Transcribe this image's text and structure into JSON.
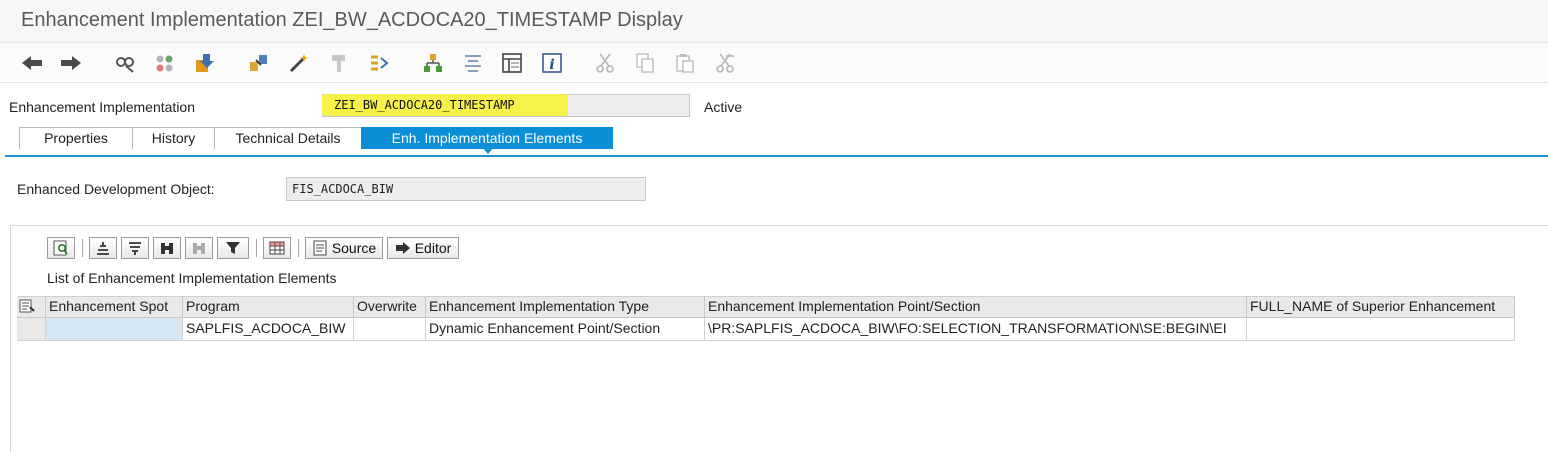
{
  "window": {
    "title": "Enhancement Implementation ZEI_BW_ACDOCA20_TIMESTAMP Display"
  },
  "toolbar": {
    "buttons": [
      {
        "icon": "back-arrow-icon"
      },
      {
        "icon": "forward-arrow-icon"
      },
      {
        "icon": "display-change-icon"
      },
      {
        "icon": "other-object-icon"
      },
      {
        "icon": "activate-icon"
      },
      {
        "icon": "where-used-icon"
      },
      {
        "icon": "magic-wand-icon"
      },
      {
        "icon": "hammer-icon"
      },
      {
        "icon": "enhance-icon"
      },
      {
        "icon": "hierarchy-icon"
      },
      {
        "icon": "align-icon"
      },
      {
        "icon": "layout-icon"
      },
      {
        "icon": "info-icon"
      },
      {
        "icon": "cut-icon"
      },
      {
        "icon": "copy-icon"
      },
      {
        "icon": "paste-icon"
      },
      {
        "icon": "undo-cut-icon"
      }
    ]
  },
  "header": {
    "impl_label": "Enhancement Implementation",
    "impl_value": "ZEI_BW_ACDOCA20_TIMESTAMP",
    "status": "Active"
  },
  "tabs": [
    {
      "label": "Properties"
    },
    {
      "label": "History"
    },
    {
      "label": "Technical Details"
    },
    {
      "label": "Enh. Implementation Elements",
      "active": true
    }
  ],
  "dev_object": {
    "label": "Enhanced Development Object:",
    "value": "FIS_ACDOCA_BIW"
  },
  "grid": {
    "toolbar": {
      "source_label": "Source",
      "editor_label": "Editor"
    },
    "title": "List of Enhancement Implementation Elements",
    "columns": [
      "Enhancement Spot",
      "Program",
      "Overwrite",
      "Enhancement Implementation Type",
      "Enhancement Implementation Point/Section",
      "FULL_NAME of Superior Enhancement"
    ],
    "rows": [
      [
        "",
        "SAPLFIS_ACDOCA_BIW",
        "",
        "Dynamic Enhancement Point/Section",
        "\\PR:SAPLFIS_ACDOCA_BIW\\FO:SELECTION_TRANSFORMATION\\SE:BEGIN\\EI",
        ""
      ]
    ]
  },
  "colors": {
    "accent": "#0a8fd6",
    "highlight": "#f6f24a"
  }
}
